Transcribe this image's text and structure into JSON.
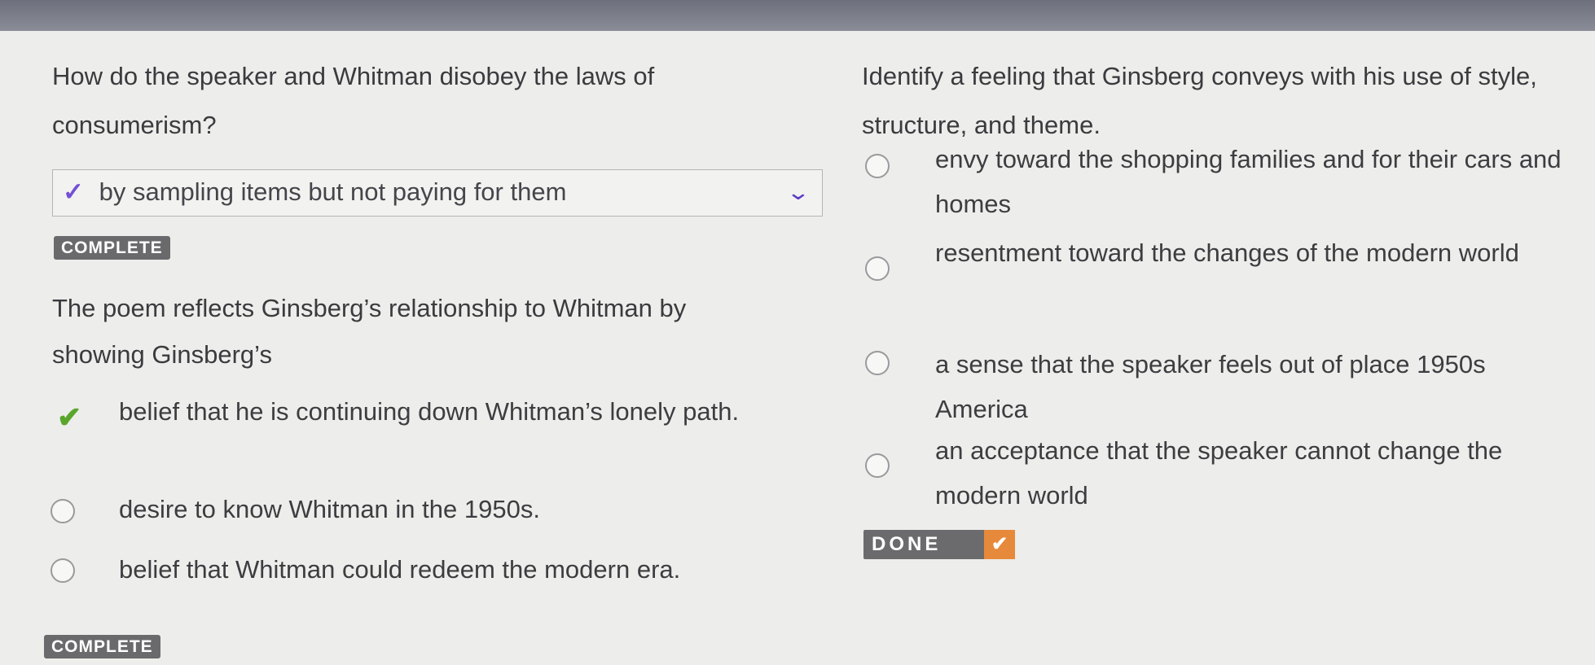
{
  "question_1": {
    "text": "How do the speaker and Whitman disobey the laws of consumerism?",
    "selected_answer": "by sampling items but not paying for them",
    "status": "COMPLETE"
  },
  "question_2": {
    "text": "The poem reflects Ginsberg’s relationship to Whitman by showing Ginsberg’s",
    "options": [
      "belief that he is continuing down Whitman’s lonely path.",
      "desire to know Whitman in the 1950s.",
      "belief that Whitman could redeem the modern era."
    ],
    "selected_index": 0,
    "status": "COMPLETE"
  },
  "question_3": {
    "text": "Identify a feeling that Ginsberg conveys with his use of style, structure, and theme.",
    "options": [
      "envy toward the shopping families and for their cars and homes",
      "resentment toward the changes of the modern world",
      "a sense that the speaker feels out of place 1950s America",
      "an acceptance that the speaker cannot change the modern world"
    ]
  },
  "done_button": {
    "label": "DONE"
  },
  "colors": {
    "check_green": "#5aa62b",
    "check_purple": "#7350d6",
    "done_accent": "#e7893a",
    "badge_gray": "#6a6a6c"
  },
  "icons": {
    "dropdown": "chevron-down-icon",
    "selected": "checkmark-icon",
    "done": "checkmark-icon"
  }
}
